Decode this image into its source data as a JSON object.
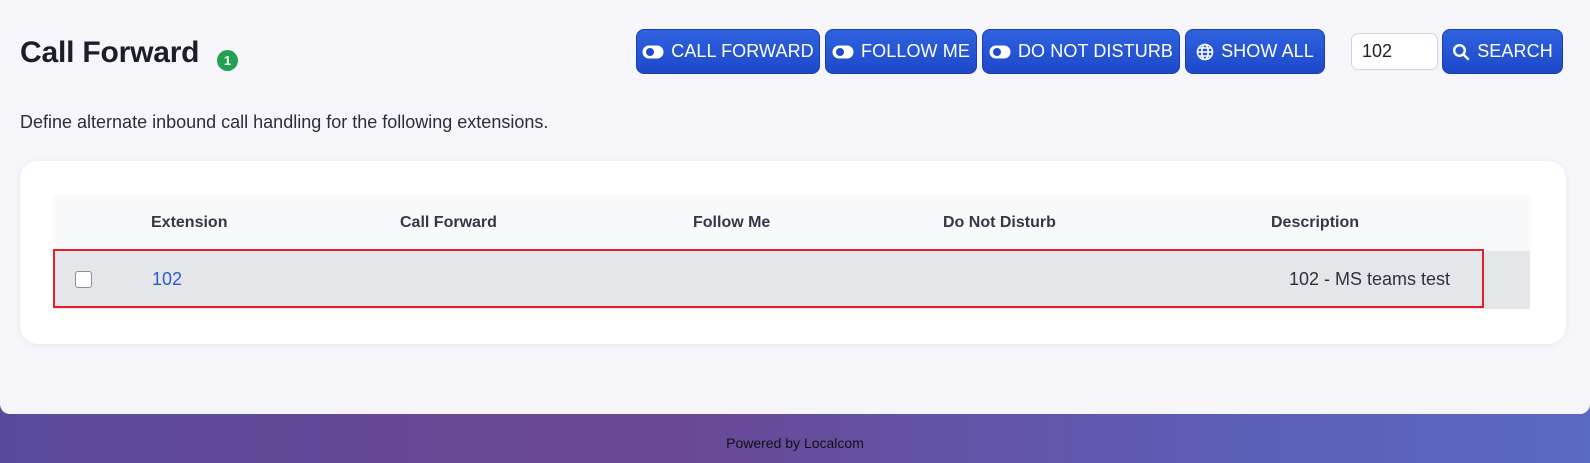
{
  "page": {
    "title": "Call Forward",
    "count_badge": "1",
    "description": "Define alternate inbound call handling for the following extensions."
  },
  "toolbar": {
    "call_forward_label": "CALL FORWARD",
    "follow_me_label": "FOLLOW ME",
    "do_not_disturb_label": "DO NOT DISTURB",
    "show_all_label": "SHOW ALL",
    "search_value": "102",
    "search_label": "SEARCH"
  },
  "table": {
    "columns": [
      "Extension",
      "Call Forward",
      "Follow Me",
      "Do Not Disturb",
      "Description"
    ],
    "rows": [
      {
        "extension": "102",
        "call_forward": "",
        "follow_me": "",
        "do_not_disturb": "",
        "description": "102 - MS teams test",
        "checked": false
      }
    ]
  },
  "footer": {
    "text": "Powered by Localcom"
  },
  "colors": {
    "button_blue": "#2f62df",
    "badge_green": "#22a251",
    "link_blue": "#2a5ad4",
    "highlight_red": "#e1202a"
  },
  "icons": {
    "toggle": "toggle-icon",
    "globe": "globe-icon",
    "search": "search-icon"
  }
}
